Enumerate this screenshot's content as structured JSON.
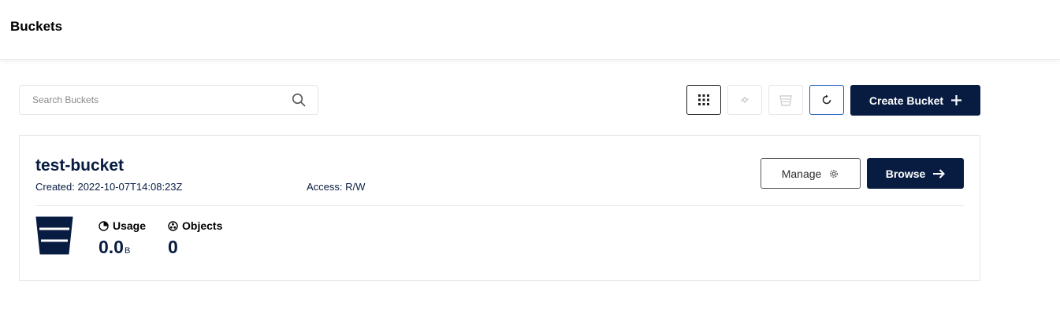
{
  "header": {
    "title": "Buckets"
  },
  "toolbar": {
    "search_placeholder": "Search Buckets",
    "search_value": "",
    "create_bucket_label": "Create Bucket"
  },
  "icons": {
    "search": "search-icon",
    "grid": "grid-icon",
    "replicate": "replicate-icon",
    "delete": "delete-icon",
    "refresh": "refresh-icon",
    "plus": "plus-icon",
    "gear": "gear-icon",
    "arrow": "arrow-right-icon",
    "bucket": "bucket-icon",
    "usage": "pie-icon",
    "objects": "objects-icon"
  },
  "bucket": {
    "name": "test-bucket",
    "created": "Created: 2022-10-07T14:08:23Z",
    "access": "Access: R/W",
    "manage_label": "Manage",
    "browse_label": "Browse",
    "usage_label": "Usage",
    "usage_value": "0.0",
    "usage_unit": "B",
    "objects_label": "Objects",
    "objects_value": "0"
  },
  "colors": {
    "primary": "#081c42",
    "refresh_border": "#1d5bbf",
    "disabled_icon": "#c8c8c8"
  }
}
